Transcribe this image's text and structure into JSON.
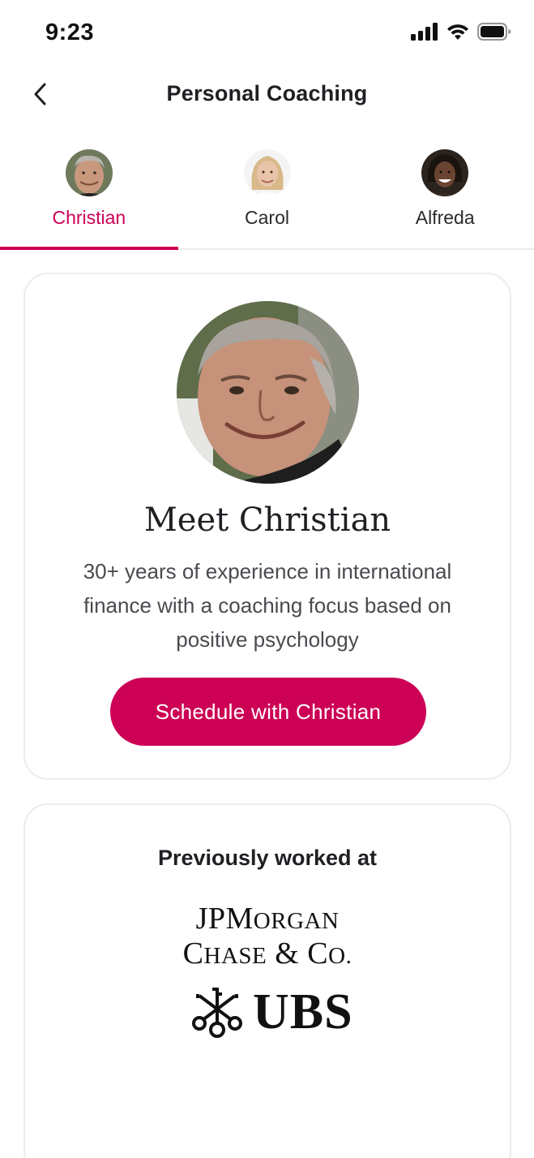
{
  "status_bar": {
    "time": "9:23",
    "icons": [
      "signal-icon",
      "wifi-icon",
      "battery-icon"
    ]
  },
  "header": {
    "back_icon": "chevron-left-icon",
    "title": "Personal Coaching"
  },
  "tabs": [
    {
      "label": "Christian",
      "active": true,
      "avatar": "avatar-christian"
    },
    {
      "label": "Carol",
      "active": false,
      "avatar": "avatar-carol"
    },
    {
      "label": "Alfreda",
      "active": false,
      "avatar": "avatar-alfreda"
    }
  ],
  "coach": {
    "heading": "Meet Christian",
    "bio": "30+ years of experience in international finance with a coaching focus based on positive psychology",
    "button_label": "Schedule with Christian"
  },
  "work": {
    "heading": "Previously worked at",
    "logos": [
      {
        "name": "jpmorgan-logo",
        "line1_prefix": "JP",
        "line1_big": "M",
        "line1_small": "ORGAN",
        "line2_big1": "C",
        "line2_small1": "HASE",
        "line2_amp": " & ",
        "line2_big2": "C",
        "line2_small2": "O."
      },
      {
        "name": "ubs-logo",
        "text": "UBS"
      }
    ]
  },
  "colors": {
    "accent": "#cc0055",
    "text": "#1f1f24",
    "muted_text": "#4a4a50",
    "border": "#ececec"
  }
}
